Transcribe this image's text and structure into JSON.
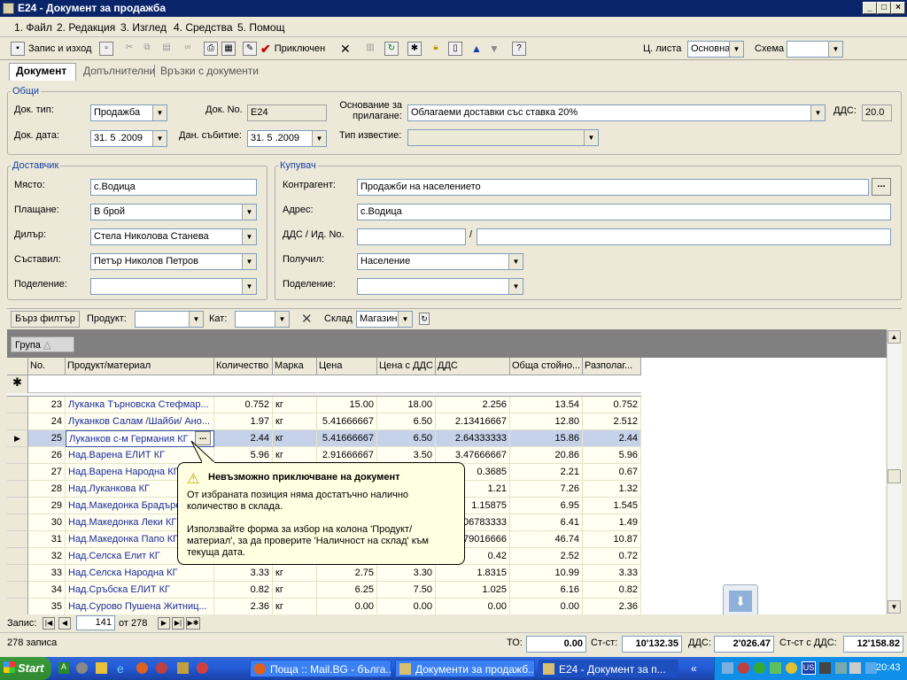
{
  "window": {
    "title": "E24 - Документ за продажба"
  },
  "menu": [
    "1. Файл",
    "2. Редакция",
    "3. Изглед",
    "4. Средства",
    "5. Помощ"
  ],
  "toolbar": {
    "save_exit": "Запис и изход",
    "complete": "Приключен",
    "price_list_label": "Ц. листа",
    "price_list_value": "Основна",
    "scheme_label": "Схема",
    "scheme_value": ""
  },
  "tabs": [
    "Документ",
    "Допълнителни",
    "Връзки с документи"
  ],
  "general": {
    "legend": "Общи",
    "doc_type_label": "Док. тип:",
    "doc_type": "Продажба",
    "doc_no_label": "Док. No.",
    "doc_no": "E24",
    "basis_label": "Основание за прилагане:",
    "basis": "Облагаеми доставки със ставка 20%",
    "vat_label": "ДДС:",
    "vat": "20.0",
    "doc_date_label": "Док. дата:",
    "doc_date": "31. 5 .2009",
    "tax_date_label": "Дан. събитие:",
    "tax_date": "31. 5 .2009",
    "notice_label": "Тип известие:",
    "notice": ""
  },
  "supplier": {
    "legend": "Доставчик",
    "place_label": "Място:",
    "place": "с.Водица",
    "payment_label": "Плащане:",
    "payment": "В брой",
    "dealer_label": "Дилър:",
    "dealer": "Стела Николова Станева",
    "creator_label": "Съставил:",
    "creator": "Петър Николов Петров",
    "division_label": "Поделение:",
    "division": ""
  },
  "buyer": {
    "legend": "Купувач",
    "contragent_label": "Контрагент:",
    "contragent": "Продажби на населението",
    "address_label": "Адрес:",
    "address": "с.Водица",
    "vatid_label": "ДДС / Ид. No.",
    "vat_no": "",
    "id_no": "",
    "receiver_label": "Получил:",
    "receiver": "Население",
    "division_label": "Поделение:",
    "division": ""
  },
  "filter": {
    "quick": "Бърз филтър",
    "product_label": "Продукт:",
    "product": "",
    "cat_label": "Кат:",
    "cat": "",
    "warehouse_label": "Склад",
    "warehouse": "Магазин"
  },
  "group_header": "Група",
  "columns": [
    "No.",
    "Продукт/материал",
    "Количество",
    "Марка",
    "Цена",
    "Цена с ДДС",
    "ДДС",
    "Обща стойно...",
    "Разполаг..."
  ],
  "rows": [
    [
      "23",
      "Луканка Търновска Стефмар...",
      "0.752",
      "кг",
      "15.00",
      "18.00",
      "2.256",
      "13.54",
      "0.752"
    ],
    [
      "24",
      "Луканков Салам /Шайби/ Ано...",
      "1.97",
      "кг",
      "5.41666667",
      "6.50",
      "2.13416667",
      "12.80",
      "2.512"
    ],
    [
      "25",
      "Луканков с-м Германия КГ",
      "2.44",
      "кг",
      "5.41666667",
      "6.50",
      "2.64333333",
      "15.86",
      "2.44"
    ],
    [
      "26",
      "Над.Варена ЕЛИТ КГ",
      "5.96",
      "кг",
      "2.91666667",
      "3.50",
      "3.47666667",
      "20.86",
      "5.96"
    ],
    [
      "27",
      "Над.Варена Народна КГ",
      "",
      "",
      "",
      "",
      "0.3685",
      "2.21",
      "0.67"
    ],
    [
      "28",
      "Над.Луканкова КГ",
      "",
      "",
      "",
      "",
      "1.21",
      "7.26",
      "1.32"
    ],
    [
      "29",
      "Над.Македонка Брадъро...",
      "",
      "",
      "",
      "",
      "1.15875",
      "6.95",
      "1.545"
    ],
    [
      "30",
      "Над.Македонка Леки КГ",
      "",
      "",
      "",
      "",
      "06783333",
      "6.41",
      "1.49"
    ],
    [
      "31",
      "Над.Македонка Папо КГ",
      "",
      "",
      "",
      "",
      "79016666",
      "46.74",
      "10.87"
    ],
    [
      "32",
      "Над.Селска Елит КГ",
      "",
      "",
      "",
      "",
      "0.42",
      "2.52",
      "0.72"
    ],
    [
      "33",
      "Над.Селска Народна КГ",
      "3.33",
      "кг",
      "2.75",
      "3.30",
      "1.8315",
      "10.99",
      "3.33"
    ],
    [
      "34",
      "Над.Сръбска ЕЛИТ КГ",
      "0.82",
      "кг",
      "6.25",
      "7.50",
      "1.025",
      "6.16",
      "0.82"
    ],
    [
      "35",
      "Над.Сурово Пушена Житниц...",
      "2.36",
      "кг",
      "0.00",
      "0.00",
      "0.00",
      "0.00",
      "2.36"
    ]
  ],
  "tooltip": {
    "title": "Невъзможно приключване на документ",
    "line1": "От избраната позиция няма достатъчно налично количество в склада.",
    "line2": "Използвайте форма за избор на колона 'Продукт/материал', за да проверите 'Наличност на склад' към текуща дата."
  },
  "nav": {
    "record_label": "Запис:",
    "current": "141",
    "of": "от 278"
  },
  "status": {
    "records": "278 записа",
    "to_label": "ТО:",
    "to": "0.00",
    "cost_label": "Ст-ст:",
    "cost": "10'132.35",
    "vat_label": "ДДС:",
    "vat": "2'026.47",
    "total_label": "Ст-ст с ДДС:",
    "total": "12'158.82"
  },
  "taskbar": {
    "start": "Start",
    "tasks": [
      "Поща :: Mail.BG - бълга...",
      "Документи за продажб...",
      "E24 - Документ за п..."
    ],
    "time": "20:43",
    "lang": "US"
  }
}
